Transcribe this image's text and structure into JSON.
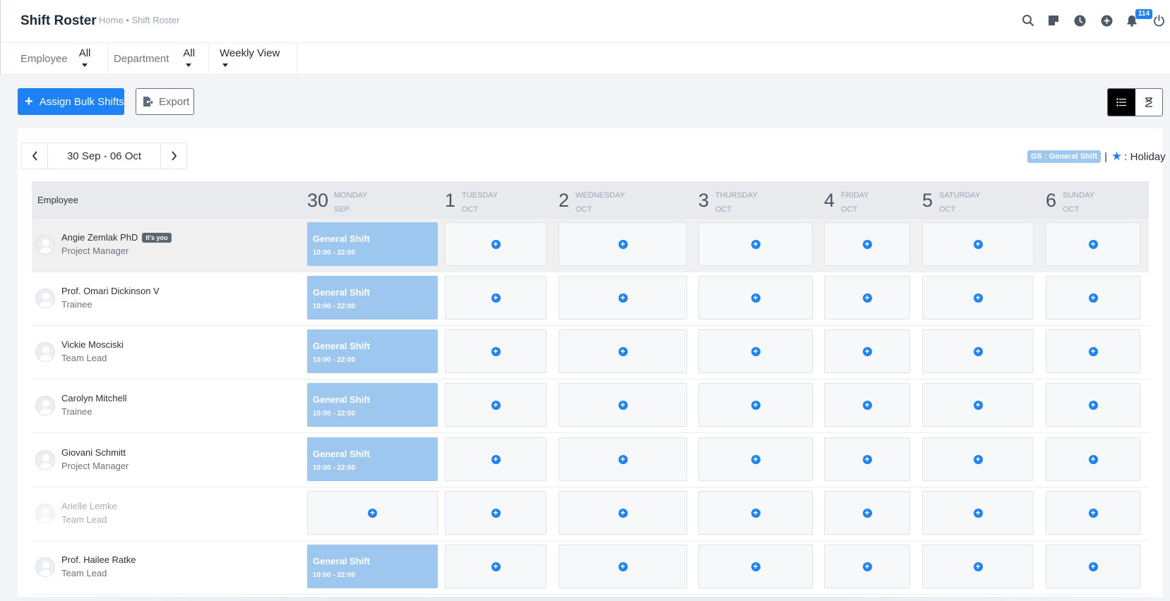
{
  "header": {
    "title": "Shift Roster",
    "breadcrumb": [
      "Home",
      "•",
      "Shift Roster"
    ],
    "notification_count": "114",
    "icons": [
      "search-icon",
      "sticky-note-icon",
      "clock-icon",
      "plus-circle-icon",
      "bell-icon",
      "power-icon"
    ]
  },
  "filters": {
    "employee_label": "Employee",
    "employee_value": "All",
    "department_label": "Department",
    "department_value": "All",
    "view_value": "Weekly View"
  },
  "actions": {
    "assign_label": "Assign Bulk Shifts",
    "export_label": "Export"
  },
  "week": {
    "range": "30 Sep - 06 Oct"
  },
  "legend": {
    "gs": "GS : General Shift",
    "separator": "|",
    "holiday": ": Holiday"
  },
  "table": {
    "employee_header": "Employee",
    "days": [
      {
        "num": "30",
        "name": "MONDAY",
        "month": "SEP"
      },
      {
        "num": "1",
        "name": "TUESDAY",
        "month": "OCT"
      },
      {
        "num": "2",
        "name": "WEDNESDAY",
        "month": "OCT"
      },
      {
        "num": "3",
        "name": "THURSDAY",
        "month": "OCT"
      },
      {
        "num": "4",
        "name": "FRIDAY",
        "month": "OCT"
      },
      {
        "num": "5",
        "name": "SATURDAY",
        "month": "OCT"
      },
      {
        "num": "6",
        "name": "SUNDAY",
        "month": "OCT"
      }
    ],
    "you_badge": "It's you",
    "shift_name": "General Shift",
    "shift_time": "10:00 - 22:00",
    "rows": [
      {
        "name": "Angie Zemlak PhD",
        "role": "Project Manager",
        "me": true,
        "inactive": false,
        "monday_shift": true
      },
      {
        "name": "Prof. Omari Dickinson V",
        "role": "Trainee",
        "me": false,
        "inactive": false,
        "monday_shift": true
      },
      {
        "name": "Vickie Mosciski",
        "role": "Team Lead",
        "me": false,
        "inactive": false,
        "monday_shift": true
      },
      {
        "name": "Carolyn Mitchell",
        "role": "Trainee",
        "me": false,
        "inactive": false,
        "monday_shift": true
      },
      {
        "name": "Giovani Schmitt",
        "role": "Project Manager",
        "me": false,
        "inactive": false,
        "monday_shift": true
      },
      {
        "name": "Arielle Lemke",
        "role": "Team Lead",
        "me": false,
        "inactive": true,
        "monday_shift": false
      },
      {
        "name": "Prof. Hailee Ratke",
        "role": "Team Lead",
        "me": false,
        "inactive": false,
        "monday_shift": true
      }
    ]
  },
  "colors": {
    "primary": "#1d82f5",
    "shift": "#9ec7f0"
  }
}
